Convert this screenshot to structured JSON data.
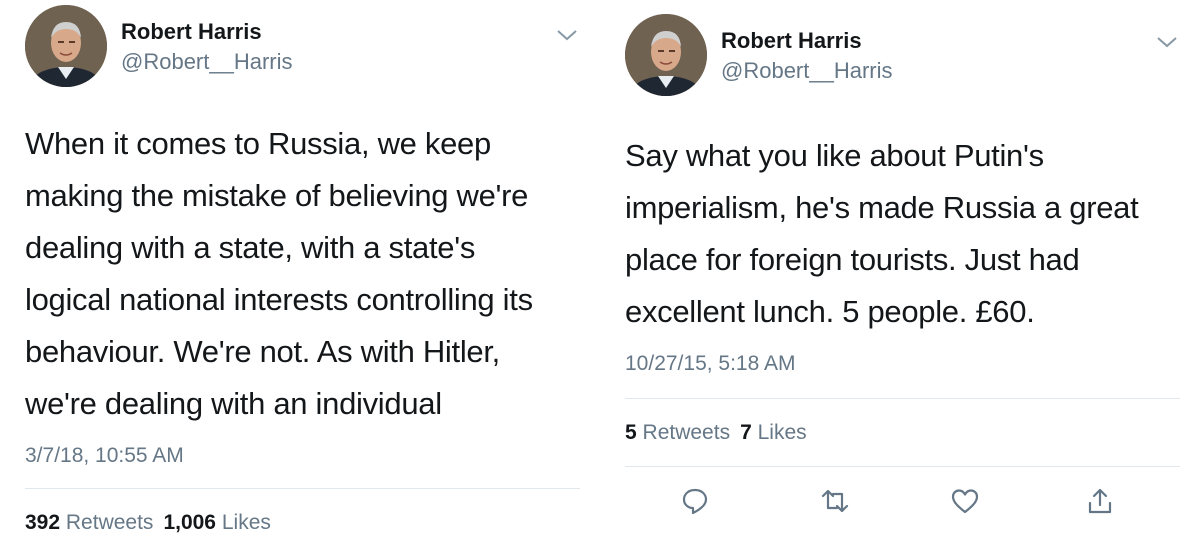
{
  "colors": {
    "text": "#14171a",
    "secondary": "#657786",
    "divider": "#e1e8ed"
  },
  "tweets": [
    {
      "author": {
        "name": "Robert Harris",
        "handle": "@Robert__Harris"
      },
      "text_lines": [
        "When it comes to Russia, we keep",
        "making the mistake of believing we're",
        "dealing with a state, with a state's",
        "logical national interests controlling its",
        "behaviour. We're not. As with Hitler,",
        "we're dealing with an individual"
      ],
      "timestamp": "3/7/18, 10:55 AM",
      "stats": {
        "retweets_count": "392",
        "retweets_label": "Retweets",
        "likes_count": "1,006",
        "likes_label": "Likes"
      }
    },
    {
      "author": {
        "name": "Robert Harris",
        "handle": "@Robert__Harris"
      },
      "text_lines": [
        "Say what you like about Putin's",
        "imperialism, he's made Russia a great",
        "place for foreign tourists. Just had",
        "excellent lunch. 5 people. £60."
      ],
      "timestamp": "10/27/15, 5:18 AM",
      "stats": {
        "retweets_count": "5",
        "retweets_label": "Retweets",
        "likes_count": "7",
        "likes_label": "Likes"
      },
      "actions": [
        "reply-icon",
        "retweet-icon",
        "like-icon",
        "share-icon"
      ]
    }
  ]
}
